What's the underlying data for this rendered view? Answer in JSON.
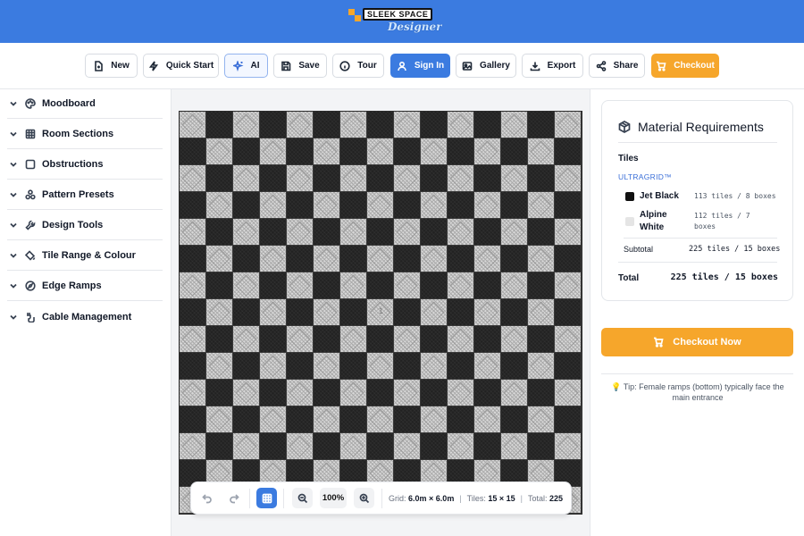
{
  "header": {
    "logo_top": "SLEEK SPACE",
    "logo_bottom": "Designer"
  },
  "toolbar": {
    "new": "New",
    "quick_start": "Quick Start",
    "ai": "AI",
    "save": "Save",
    "tour": "Tour",
    "sign_in": "Sign In",
    "gallery": "Gallery",
    "export": "Export",
    "share": "Share",
    "checkout": "Checkout"
  },
  "sidebar": {
    "items": [
      {
        "label": "Moodboard",
        "icon": "palette-icon"
      },
      {
        "label": "Room Sections",
        "icon": "grid-icon"
      },
      {
        "label": "Obstructions",
        "icon": "square-icon"
      },
      {
        "label": "Pattern Presets",
        "icon": "shapes-icon"
      },
      {
        "label": "Design Tools",
        "icon": "wrench-icon"
      },
      {
        "label": "Tile Range & Colour",
        "icon": "paint-bucket-icon"
      },
      {
        "label": "Edge Ramps",
        "icon": "compass-icon"
      },
      {
        "label": "Cable Management",
        "icon": "cable-icon"
      }
    ]
  },
  "canvas": {
    "cols": 15,
    "rows": 15,
    "colors": {
      "black": "#222222",
      "white": "#d8d8d8"
    },
    "section_label": "1",
    "zoom": "100%",
    "grid_label": "Grid:",
    "grid_value": "6.0m × 6.0m",
    "tiles_label": "Tiles:",
    "tiles_value": "15 × 15",
    "total_label": "Total:",
    "total_value": "225"
  },
  "materials": {
    "title": "Material Requirements",
    "tiles_heading": "Tiles",
    "brand": "ULTRAGRID™",
    "rows": [
      {
        "name": "Jet Black",
        "count": "113 tiles / 8 boxes",
        "color": "#111111"
      },
      {
        "name_line1": "Alpine",
        "name_line2": "White",
        "count_line1": "112 tiles / 7",
        "count_line2": "boxes",
        "color": "#e5e5e5"
      }
    ],
    "subtotal_label": "Subtotal",
    "subtotal_value": "225 tiles / 15 boxes",
    "total_label": "Total",
    "total_value": "225 tiles / 15 boxes"
  },
  "checkout_now": "Checkout Now",
  "tip": "💡 Tip: Female ramps (bottom) typically face the main entrance",
  "accent": "#3b7be0",
  "orange": "#f6a62b"
}
